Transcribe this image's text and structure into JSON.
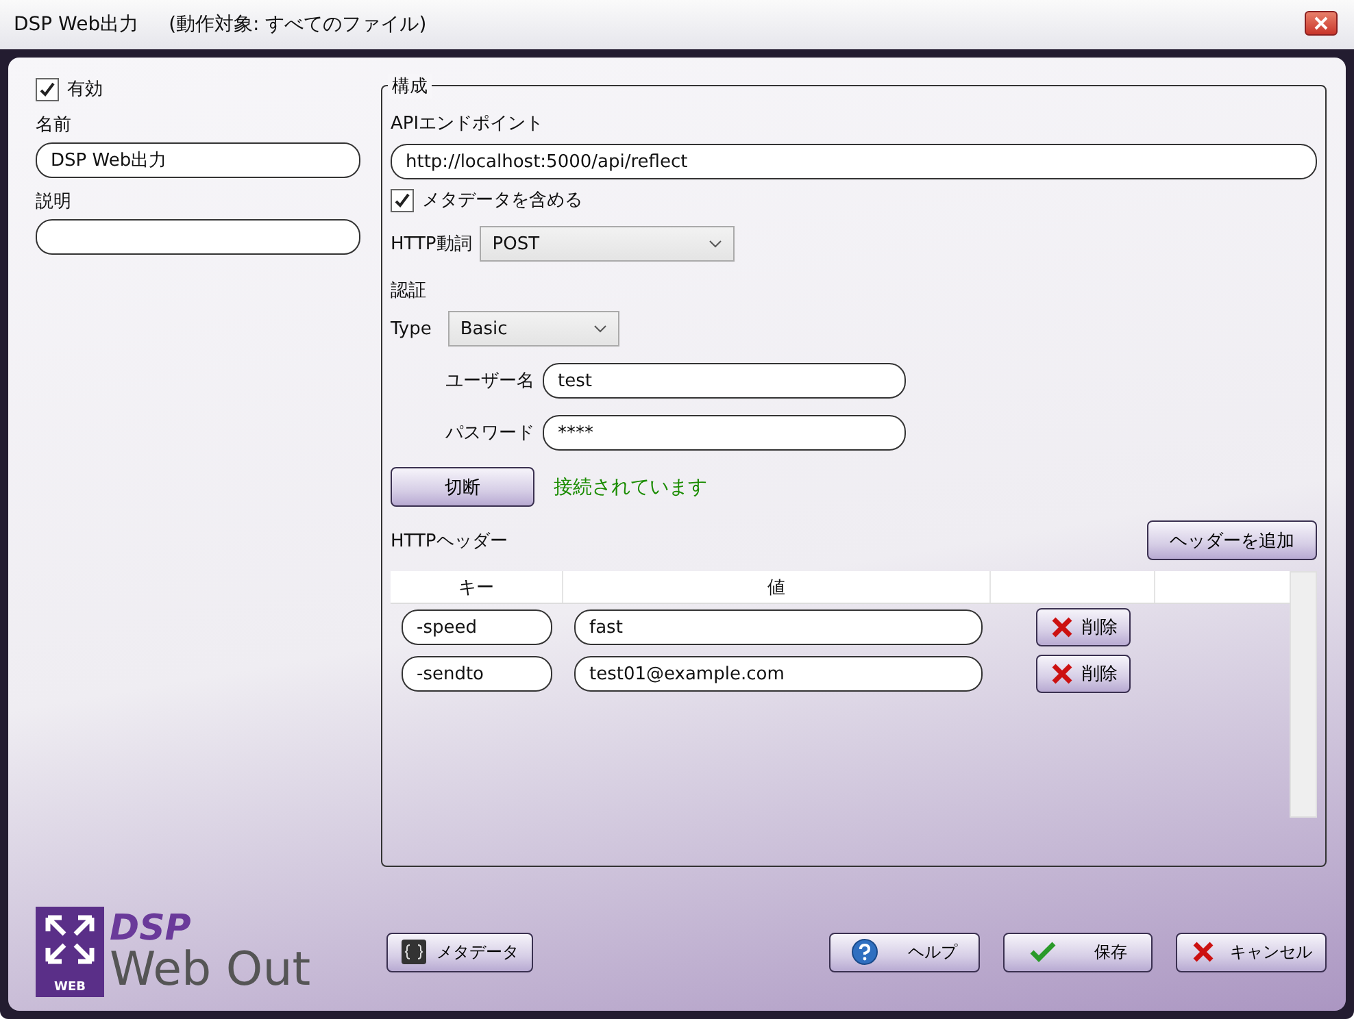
{
  "window": {
    "title": "DSP Web出力",
    "subtitle": "(動作対象: すべてのファイル)"
  },
  "enabled": {
    "label": "有効",
    "checked": true
  },
  "name": {
    "label": "名前",
    "value": "DSP Web出力"
  },
  "description": {
    "label": "説明"
  },
  "config": {
    "title": "構成",
    "endpoint": {
      "label": "APIエンドポイント",
      "value": "http://localhost:5000/api/reflect"
    },
    "include_metadata": {
      "label": "メタデータを含める",
      "checked": true
    },
    "http_verb": {
      "label": "HTTP動詞",
      "value": "POST"
    },
    "auth": {
      "title": "認証",
      "type_label": "Type",
      "type_value": "Basic",
      "username": {
        "label": "ユーザー名",
        "value": "test"
      },
      "password": {
        "label": "パスワード",
        "value": "****"
      }
    },
    "disconnect_button": "切断",
    "status": "接続されています",
    "headers": {
      "title": "HTTPヘッダー",
      "add_button": "ヘッダーを追加",
      "columns": [
        "キー",
        "値"
      ],
      "rows": [
        {
          "key": "-speed",
          "value": "fast",
          "delete": "削除"
        },
        {
          "key": "-sendto",
          "value": "test01@example.com",
          "delete": "削除"
        }
      ]
    }
  },
  "logo": {
    "line1": "DSP",
    "line2": "Web Out",
    "badge": "WEB"
  },
  "buttons": [
    {
      "kind": "metadata",
      "label": "メタデータ"
    },
    {
      "kind": "help",
      "label": "ヘルプ"
    },
    {
      "kind": "save",
      "label": "保存"
    },
    {
      "kind": "cancel",
      "label": "キャンセル"
    }
  ]
}
